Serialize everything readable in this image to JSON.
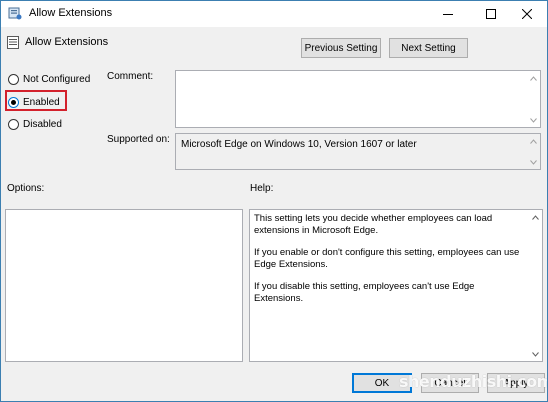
{
  "window": {
    "title": "Allow Extensions"
  },
  "header": {
    "title": "Allow Extensions"
  },
  "nav": {
    "previous_label": "Previous Setting",
    "next_label": "Next Setting"
  },
  "state": {
    "options": [
      {
        "label": "Not Configured",
        "checked": false
      },
      {
        "label": "Enabled",
        "checked": true
      },
      {
        "label": "Disabled",
        "checked": false
      }
    ]
  },
  "comment": {
    "label": "Comment:",
    "value": ""
  },
  "supported": {
    "label": "Supported on:",
    "value": "Microsoft Edge on Windows 10, Version 1607 or later"
  },
  "options_pane": {
    "label": "Options:"
  },
  "help_pane": {
    "label": "Help:",
    "paragraphs": [
      "This setting lets you decide whether employees can load extensions in Microsoft Edge.",
      "If you enable or don't configure this setting, employees can use Edge Extensions.",
      "If you disable this setting, employees can't use Edge Extensions."
    ]
  },
  "footer": {
    "ok_label": "OK",
    "cancel_label": "Cancel",
    "apply_label": "Apply"
  },
  "watermark": {
    "text": "shenduzhishi.com"
  },
  "colors": {
    "highlight": "#d3212c",
    "focus": "#0078d7"
  }
}
